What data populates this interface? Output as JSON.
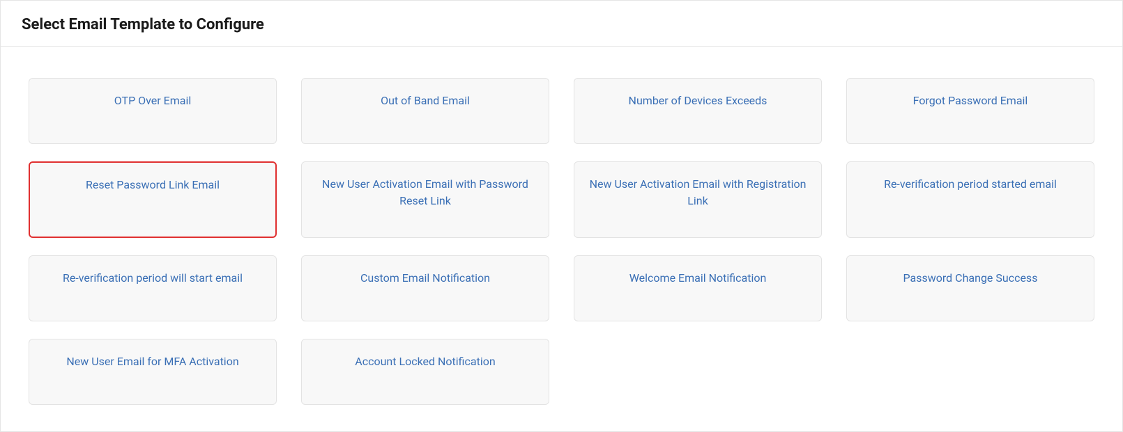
{
  "header": {
    "title": "Select Email Template to Configure"
  },
  "templates": [
    {
      "label": "OTP Over Email",
      "selected": false
    },
    {
      "label": "Out of Band Email",
      "selected": false
    },
    {
      "label": "Number of Devices Exceeds",
      "selected": false
    },
    {
      "label": "Forgot Password Email",
      "selected": false
    },
    {
      "label": "Reset Password Link Email",
      "selected": true
    },
    {
      "label": "New User Activation Email with Password Reset Link",
      "selected": false
    },
    {
      "label": "New User Activation Email with Registration Link",
      "selected": false
    },
    {
      "label": "Re-verification period started email",
      "selected": false
    },
    {
      "label": "Re-verification period will start email",
      "selected": false
    },
    {
      "label": "Custom Email Notification",
      "selected": false
    },
    {
      "label": "Welcome Email Notification",
      "selected": false
    },
    {
      "label": "Password Change Success",
      "selected": false
    },
    {
      "label": "New User Email for MFA Activation",
      "selected": false
    },
    {
      "label": "Account Locked Notification",
      "selected": false
    }
  ]
}
